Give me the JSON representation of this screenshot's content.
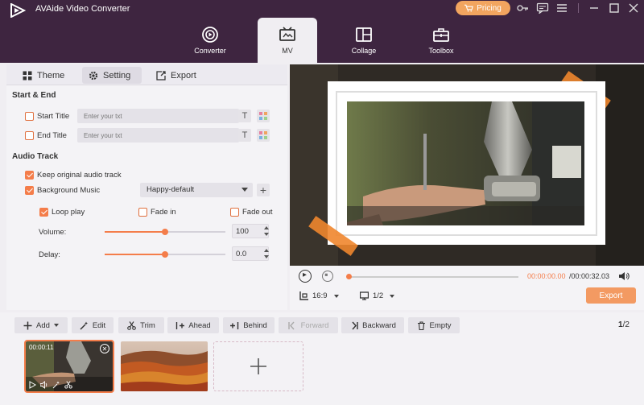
{
  "app": {
    "title": "AVAide Video Converter",
    "pricing_label": "Pricing"
  },
  "nav": {
    "tabs": [
      {
        "label": "Converter",
        "icon": "converter-icon"
      },
      {
        "label": "MV",
        "icon": "mv-icon",
        "active": true
      },
      {
        "label": "Collage",
        "icon": "collage-icon"
      },
      {
        "label": "Toolbox",
        "icon": "toolbox-icon"
      }
    ]
  },
  "subtabs": {
    "theme": "Theme",
    "setting": "Setting",
    "export": "Export"
  },
  "start_end": {
    "title": "Start & End",
    "start_title_label": "Start Title",
    "start_title_placeholder": "Enter your txt",
    "end_title_label": "End Title",
    "end_title_placeholder": "Enter your txt",
    "text_icon": "T"
  },
  "audio": {
    "title": "Audio Track",
    "keep_original_label": "Keep original audio track",
    "keep_original_checked": true,
    "background_music_label": "Background Music",
    "background_music_checked": true,
    "music_selected": "Happy-default",
    "loop_play_label": "Loop play",
    "loop_play_checked": true,
    "fade_in_label": "Fade in",
    "fade_in_checked": false,
    "fade_out_label": "Fade out",
    "fade_out_checked": false,
    "volume_label": "Volume:",
    "volume_value": "100",
    "delay_label": "Delay:",
    "delay_value": "0.0"
  },
  "player": {
    "time_current": "00:00:00.00",
    "time_total": "/00:00:32.03",
    "aspect_ratio": "16:9",
    "screen": "1/2",
    "export_label": "Export"
  },
  "toolbar": {
    "add": "Add",
    "edit": "Edit",
    "trim": "Trim",
    "ahead": "Ahead",
    "behind": "Behind",
    "forward": "Forward",
    "backward": "Backward",
    "empty": "Empty",
    "page_current": "1",
    "page_total": "/2"
  },
  "clips": [
    {
      "time": "00:00:11",
      "selected": true
    },
    {
      "time": "",
      "selected": false
    }
  ],
  "colors": {
    "accent": "#f47d4a",
    "topbar": "#3e2540",
    "pricing": "#f2a55f",
    "export": "#f39a62"
  }
}
